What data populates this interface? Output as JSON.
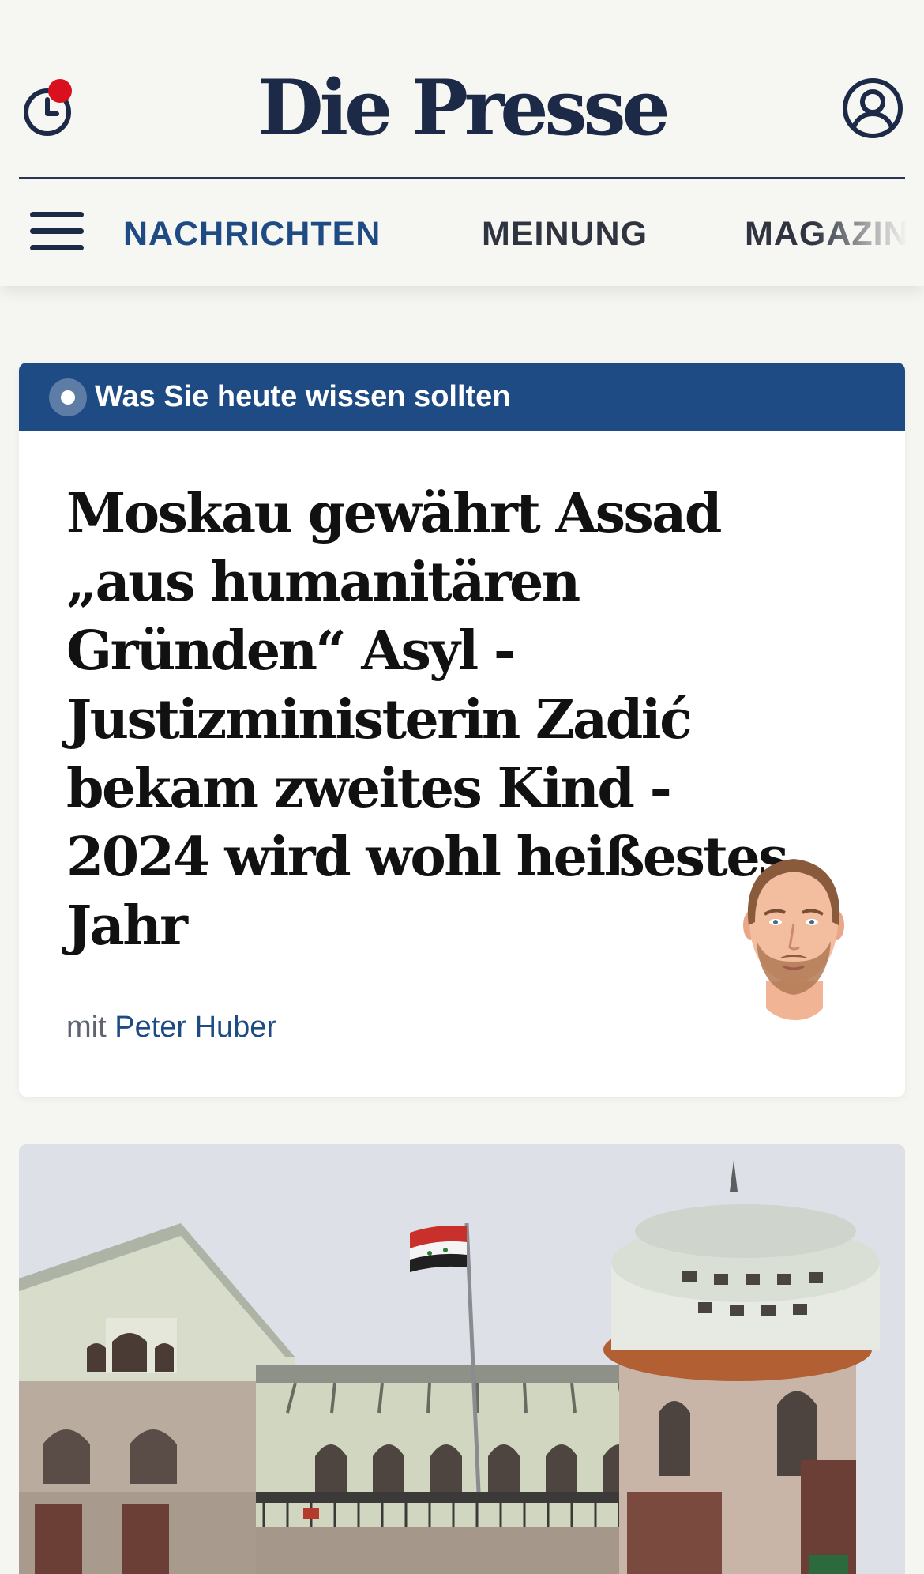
{
  "header": {
    "logo": "Die Presse",
    "history_icon": "clock-history-icon",
    "notification_dot_color": "#d9111f",
    "account_icon": "user-circle-icon",
    "menu_icon": "hamburger-menu-icon"
  },
  "nav": {
    "items": [
      {
        "label": "NACHRICHTEN",
        "active": true
      },
      {
        "label": "MEINUNG",
        "active": false
      },
      {
        "label": "MAGAZIN",
        "active": false
      }
    ]
  },
  "briefing": {
    "bar_label": "Was Sie heute wissen sollten",
    "headline": "Moskau gewährt Assad „aus humanitären Gründen“ Asyl - Justizministerin Zadić bekam zweites Kind - 2024 wird wohl heißestes Jahr",
    "byline_prefix": "mit",
    "author": "Peter Huber",
    "avatar": "author-portrait-illustration"
  },
  "lead_image": {
    "subject": "building-with-syrian-flag-photo"
  },
  "colors": {
    "brand_navy": "#1c2a47",
    "accent_blue": "#1f4b84",
    "page_background": "#f5f5f1",
    "card_background": "#ffffff",
    "notification_red": "#d9111f"
  }
}
